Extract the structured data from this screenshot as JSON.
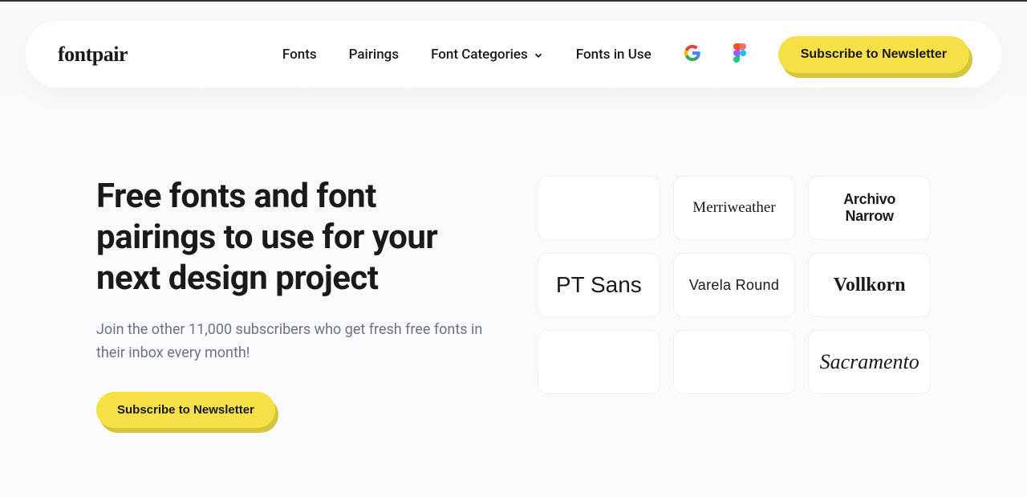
{
  "logo": "fontpair",
  "nav": {
    "fonts": "Fonts",
    "pairings": "Pairings",
    "categories": "Font Categories",
    "inuse": "Fonts in Use",
    "subscribe": "Subscribe to Newsletter"
  },
  "hero": {
    "title": "Free fonts and font pairings to use for your next design project",
    "subtitle": "Join the other 11,000 subscribers who get fresh free fonts in their inbox every month!",
    "cta": "Subscribe to Newsletter"
  },
  "fonts": {
    "card1": "",
    "card2": "Merriweather",
    "card3": "Archivo Narrow",
    "card4": "PT Sans",
    "card5": "Varela Round",
    "card6": "Vollkorn",
    "card7": "",
    "card8": "",
    "card9": "Sacramento"
  }
}
